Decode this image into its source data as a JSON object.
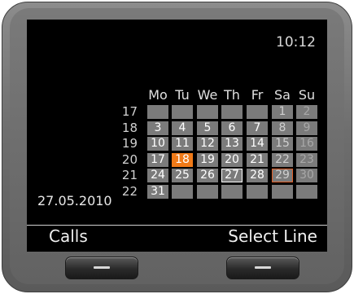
{
  "status": {
    "time": "10:12"
  },
  "calendar": {
    "day_headers": [
      "Mo",
      "Tu",
      "We",
      "Th",
      "Fr",
      "Sa",
      "Su"
    ],
    "weeks": [
      {
        "number": "17",
        "days": [
          "",
          "",
          "",
          "",
          "",
          "1",
          "2"
        ]
      },
      {
        "number": "18",
        "days": [
          "3",
          "4",
          "5",
          "6",
          "7",
          "8",
          "9"
        ]
      },
      {
        "number": "19",
        "days": [
          "10",
          "11",
          "12",
          "13",
          "14",
          "15",
          "16"
        ]
      },
      {
        "number": "20",
        "days": [
          "17",
          "18",
          "19",
          "20",
          "21",
          "22",
          "23"
        ]
      },
      {
        "number": "21",
        "days": [
          "24",
          "25",
          "26",
          "27",
          "28",
          "29",
          "30"
        ]
      },
      {
        "number": "22",
        "days": [
          "31",
          "",
          "",
          "",
          "",
          "",
          ""
        ]
      }
    ],
    "today": "18",
    "selected": "27",
    "marked": "29",
    "selected_date": "27.05.2010",
    "colors": {
      "cell": "#7b7b7b",
      "today": "#f07a18",
      "marked_border": "#e0602a"
    }
  },
  "softkeys": {
    "left": "Calls",
    "right": "Select Line"
  }
}
